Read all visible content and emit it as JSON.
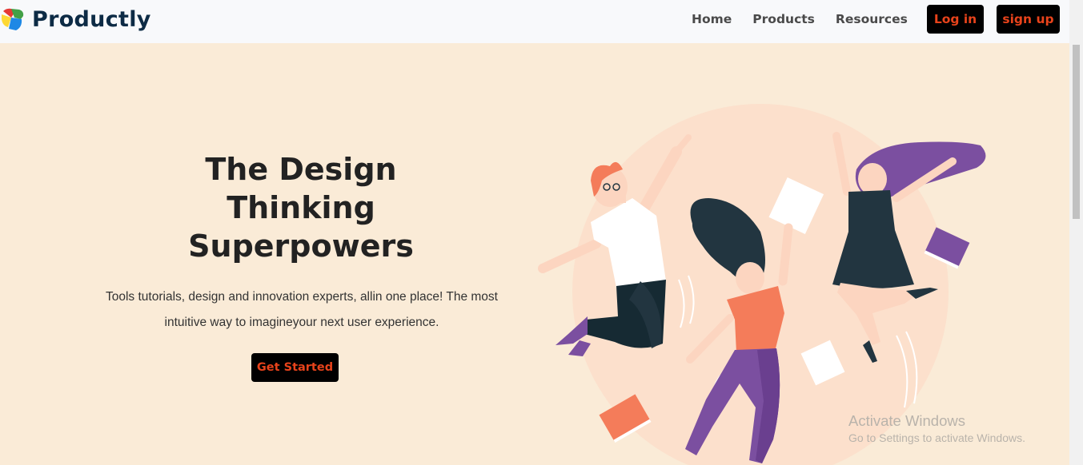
{
  "brand": {
    "name": "Productly"
  },
  "nav": {
    "links": [
      "Home",
      "Products",
      "Resources"
    ],
    "login_label": "Log in",
    "signup_label": "sign up"
  },
  "hero": {
    "title": "The Design\nThinking\nSuperpowers",
    "description": "Tools tutorials, design and innovation experts, allin one place! The most intuitive way to imagineyour next user experience.",
    "cta_label": "Get Started"
  },
  "watermark": {
    "title": "Activate Windows",
    "subtitle": "Go to Settings to activate Windows."
  },
  "colors": {
    "page_background": "#faebd7",
    "navbar_background": "#f8f9fb",
    "button_background": "#000000",
    "button_text": "#e8431b",
    "brand_text": "#0d2b45",
    "illustration_circle": "#fcdcc8",
    "accent_orange": "#f47c5a",
    "accent_purple": "#7b4fa0",
    "dark_navy": "#223540"
  },
  "icons": {
    "brand_logo": "productly-logo-icon"
  }
}
